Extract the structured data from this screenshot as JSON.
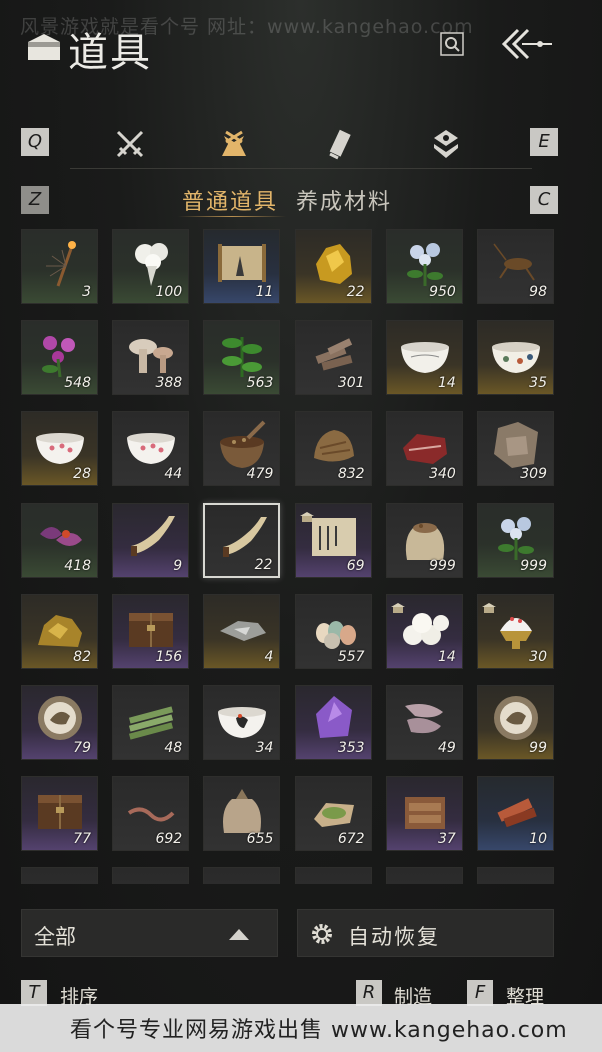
{
  "watermark_top": "风景游戏就是看个号  网址：www.kangehao.com",
  "header": {
    "title": "道具"
  },
  "tabbar": {
    "left_key": "Q",
    "right_key": "E"
  },
  "subtabs": {
    "left_key": "Z",
    "right_key": "C",
    "active": "普通道具",
    "inactive": "养成材料"
  },
  "items": [
    {
      "count": "3",
      "rarity": "green",
      "art": "incense-icon"
    },
    {
      "count": "100",
      "rarity": "green",
      "art": "white-flower-icon"
    },
    {
      "count": "11",
      "rarity": "blue",
      "art": "scroll-painting-icon"
    },
    {
      "count": "22",
      "rarity": "gold",
      "art": "gold-nugget-icon"
    },
    {
      "count": "950",
      "rarity": "green",
      "art": "blue-flower-icon"
    },
    {
      "count": "98",
      "rarity": "gray",
      "art": "cricket-icon"
    },
    {
      "count": "548",
      "rarity": "green",
      "art": "purple-flower-icon"
    },
    {
      "count": "388",
      "rarity": "gray",
      "art": "mushroom-icon"
    },
    {
      "count": "563",
      "rarity": "green",
      "art": "herb-icon"
    },
    {
      "count": "301",
      "rarity": "gray",
      "art": "wood-pieces-icon"
    },
    {
      "count": "14",
      "rarity": "gold",
      "art": "porcelain-bowl-icon"
    },
    {
      "count": "35",
      "rarity": "gold",
      "art": "painted-bowl-icon"
    },
    {
      "count": "28",
      "rarity": "gold",
      "art": "plum-bowl-icon"
    },
    {
      "count": "44",
      "rarity": "gray",
      "art": "plum-bowl-icon"
    },
    {
      "count": "479",
      "rarity": "gray",
      "art": "mortar-icon"
    },
    {
      "count": "832",
      "rarity": "gray",
      "art": "tobacco-icon"
    },
    {
      "count": "340",
      "rarity": "gray",
      "art": "meat-icon"
    },
    {
      "count": "309",
      "rarity": "gray",
      "art": "hide-icon"
    },
    {
      "count": "418",
      "rarity": "green",
      "art": "purple-petals-icon"
    },
    {
      "count": "9",
      "rarity": "purple",
      "art": "horn-icon"
    },
    {
      "count": "22",
      "rarity": "gray",
      "art": "horn-icon",
      "selected": true
    },
    {
      "count": "69",
      "rarity": "purple",
      "art": "letter-icon",
      "badge": true
    },
    {
      "count": "999",
      "rarity": "gray",
      "art": "grain-sack-icon"
    },
    {
      "count": "999",
      "rarity": "green",
      "art": "blue-flower-icon"
    },
    {
      "count": "82",
      "rarity": "gold",
      "art": "ore-icon"
    },
    {
      "count": "156",
      "rarity": "purple",
      "art": "chest-icon"
    },
    {
      "count": "4",
      "rarity": "gold",
      "art": "crystal-shard-icon"
    },
    {
      "count": "557",
      "rarity": "gray",
      "art": "eggs-icon"
    },
    {
      "count": "14",
      "rarity": "purple",
      "art": "buns-icon",
      "badge": true
    },
    {
      "count": "30",
      "rarity": "gold",
      "art": "shaved-ice-icon",
      "badge": true
    },
    {
      "count": "79",
      "rarity": "purple",
      "art": "bird-token-icon"
    },
    {
      "count": "48",
      "rarity": "gray",
      "art": "bamboo-bundle-icon"
    },
    {
      "count": "34",
      "rarity": "gray",
      "art": "rooster-bowl-icon"
    },
    {
      "count": "353",
      "rarity": "purple",
      "art": "amethyst-icon"
    },
    {
      "count": "49",
      "rarity": "gray",
      "art": "cloth-roll-icon"
    },
    {
      "count": "99",
      "rarity": "gold",
      "art": "bird-token-icon"
    },
    {
      "count": "77",
      "rarity": "purple",
      "art": "chest-icon"
    },
    {
      "count": "692",
      "rarity": "gray",
      "art": "worm-icon"
    },
    {
      "count": "655",
      "rarity": "gray",
      "art": "cloth-sack-icon"
    },
    {
      "count": "672",
      "rarity": "gray",
      "art": "green-powder-icon"
    },
    {
      "count": "37",
      "rarity": "purple",
      "art": "carved-box-icon"
    },
    {
      "count": "10",
      "rarity": "blue",
      "art": "dried-meat-icon"
    },
    {
      "count": "",
      "rarity": "gray",
      "art": "partial-icon"
    },
    {
      "count": "",
      "rarity": "gray",
      "art": "partial-icon"
    },
    {
      "count": "",
      "rarity": "gray",
      "art": "partial-icon"
    },
    {
      "count": "",
      "rarity": "gray",
      "art": "partial-icon"
    },
    {
      "count": "",
      "rarity": "gray",
      "art": "partial-icon"
    },
    {
      "count": "",
      "rarity": "gray",
      "art": "partial-icon"
    }
  ],
  "filter": {
    "label": "全部"
  },
  "auto_recover": {
    "label": "自动恢复"
  },
  "actions": [
    {
      "key": "T",
      "label": "排序"
    },
    {
      "key": "R",
      "label": "制造"
    },
    {
      "key": "F",
      "label": "整理"
    }
  ],
  "footer_watermark": "看个号专业网易游戏出售  www.kangehao.com"
}
